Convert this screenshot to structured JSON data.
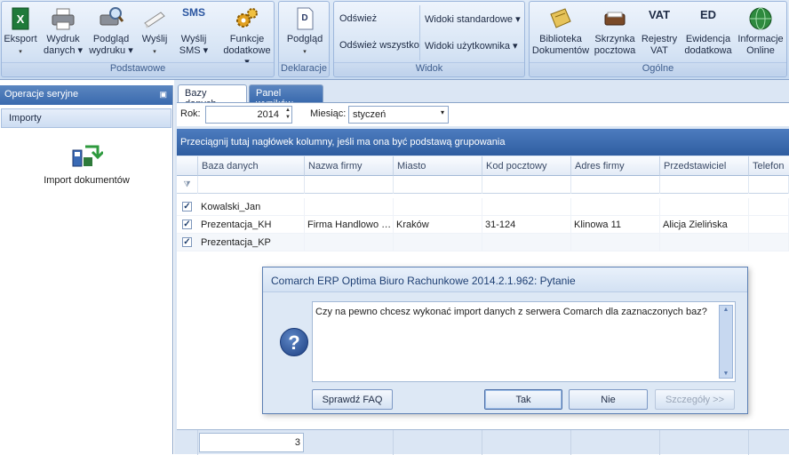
{
  "ribbon": {
    "groups": [
      {
        "label": "Podstawowe"
      },
      {
        "label": "Deklaracje"
      },
      {
        "label": "Widok"
      },
      {
        "label": "Ogólne"
      }
    ],
    "eksport": {
      "l1": "Eksport",
      "l2": "▾"
    },
    "wydruk": {
      "l1": "Wydruk",
      "l2": "danych ▾"
    },
    "podglad_wydruku": {
      "l1": "Podgląd",
      "l2": "wydruku ▾"
    },
    "wyslij": {
      "l1": "Wyślij",
      "l2": "▾"
    },
    "wyslij_sms": {
      "l1": "Wyślij",
      "l2": "SMS ▾",
      "icon": "SMS"
    },
    "funkcje": {
      "l1": "Funkcje",
      "l2": "dodatkowe ▾"
    },
    "podglad": {
      "l1": "Podgląd",
      "l2": "▾"
    },
    "odswiez": "Odśwież",
    "odswiez_wszystko": "Odśwież wszystko",
    "widoki_standardowe": "Widoki standardowe ▾",
    "widoki_uzytkownika": "Widoki użytkownika ▾",
    "biblioteka": {
      "l1": "Biblioteka",
      "l2": "Dokumentów"
    },
    "skrzynka": {
      "l1": "Skrzynka",
      "l2": "pocztowa"
    },
    "rejestry": {
      "l1": "Rejestry",
      "l2": "VAT",
      "icon": "VAT"
    },
    "ewidencja": {
      "l1": "Ewidencja",
      "l2": "dodatkowa",
      "icon": "ED"
    },
    "informacje": {
      "l1": "Informacje",
      "l2": "Online"
    }
  },
  "left_panel": {
    "title": "Operacje seryjne",
    "section": "Importy",
    "item": "Import dokumentów"
  },
  "tabs": [
    "Bazy danych",
    "Panel wyników"
  ],
  "filters": {
    "rok_label": "Rok:",
    "rok_value": "2014",
    "miesiac_label": "Miesiąc:",
    "miesiac_value": "styczeń"
  },
  "group_hint": "Przeciągnij tutaj nagłówek kolumny, jeśli ma ona być podstawą grupowania",
  "columns": [
    "Baza danych",
    "Nazwa firmy",
    "Miasto",
    "Kod pocztowy",
    "Adres firmy",
    "Przedstawiciel",
    "Telefon"
  ],
  "rows": [
    {
      "checked": "✓",
      "baza": "Kowalski_Jan",
      "firma": "",
      "miasto": "",
      "kod": "",
      "adres": "",
      "przed": "",
      "tel": ""
    },
    {
      "checked": "✓",
      "baza": "Prezentacja_KH",
      "firma": "Firma Handlowo …",
      "miasto": "Kraków",
      "kod": "31-124",
      "adres": "Klinowa 11",
      "przed": "Alicja Zielińska",
      "tel": ""
    },
    {
      "checked": "✓",
      "baza": "Prezentacja_KP",
      "firma": "",
      "miasto": "",
      "kod": "",
      "adres": "",
      "przed": "",
      "tel": ""
    }
  ],
  "footer_count": "3",
  "dialog": {
    "title": "Comarch ERP Optima Biuro Rachunkowe 2014.2.1.962: Pytanie",
    "message": "Czy na pewno chcesz wykonać import danych z serwera Comarch dla zaznaczonych baz?",
    "icon": "?",
    "faq": "Sprawdź FAQ",
    "yes": "Tak",
    "no": "Nie",
    "details": "Szczegóły >>"
  },
  "colors": {
    "accent": "#3a6aae",
    "ribbon": "#d5e3f4"
  }
}
